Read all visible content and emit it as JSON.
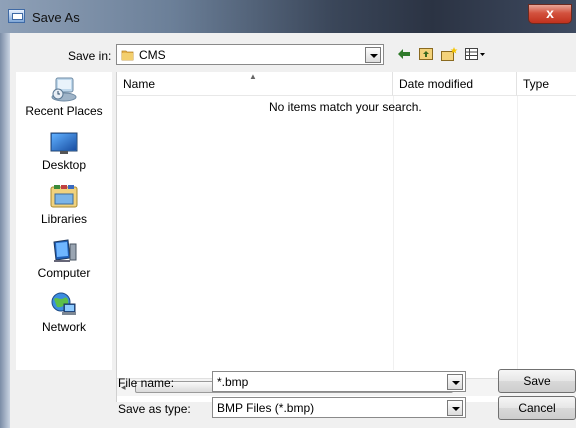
{
  "window": {
    "title": "Save As",
    "close_glyph": "x"
  },
  "toolbar": {
    "save_in_label": "Save in:",
    "save_in_value": "CMS",
    "back_icon": "back-arrow-icon",
    "up_icon": "up-folder-icon",
    "new_folder_icon": "new-folder-icon",
    "view_menu_icon": "view-menu-icon"
  },
  "places": [
    {
      "label": "Recent Places",
      "icon": "recent-places-icon"
    },
    {
      "label": "Desktop",
      "icon": "desktop-icon"
    },
    {
      "label": "Libraries",
      "icon": "libraries-icon"
    },
    {
      "label": "Computer",
      "icon": "computer-icon"
    },
    {
      "label": "Network",
      "icon": "network-icon"
    }
  ],
  "list": {
    "columns": [
      "Name",
      "Date modified",
      "Type"
    ],
    "empty_message": "No items match your search.",
    "scroll_grip": "III"
  },
  "form": {
    "file_name_label": "File name:",
    "file_name_value": "*.bmp",
    "save_type_label": "Save as type:",
    "save_type_value": "BMP Files (*.bmp)"
  },
  "buttons": {
    "save": "Save",
    "cancel": "Cancel"
  },
  "colors": {
    "close_button": "#c1311d",
    "folder": "#e7b34a"
  }
}
